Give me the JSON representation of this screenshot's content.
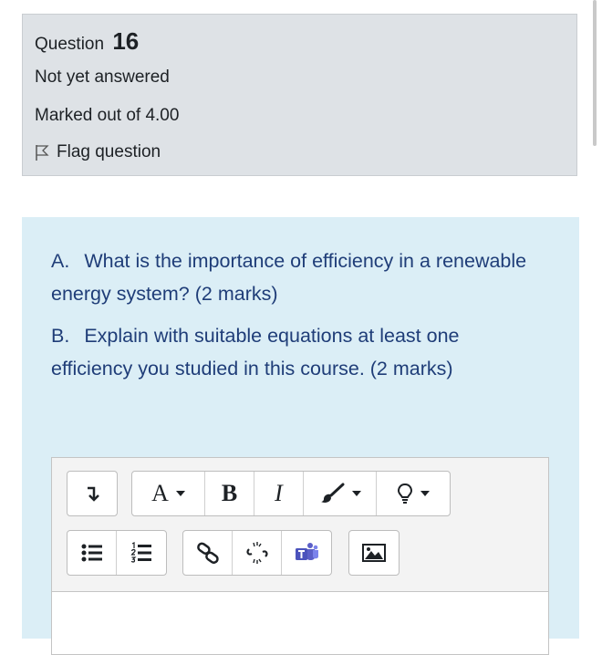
{
  "question_info": {
    "label": "Question",
    "number": "16",
    "state": "Not yet answered",
    "grade": "Marked out of 4.00",
    "flag_label": "Flag question"
  },
  "question_text": {
    "parts": [
      {
        "label": "A.",
        "text": "What is the importance of efficiency in a renewable energy system? (2 marks)"
      },
      {
        "label": "B.",
        "text": "Explain with suitable equations at least one efficiency you studied in this course. (2 marks)"
      }
    ]
  },
  "editor": {
    "row1": [
      "toggle-toolbar-icon",
      "font-size-icon",
      "bold-icon",
      "italic-icon",
      "brush-icon",
      "lightbulb-icon"
    ],
    "row2": [
      "bullet-list-icon",
      "numbered-list-icon",
      "link-icon",
      "unlink-icon",
      "teams-icon",
      "image-icon"
    ],
    "font_button": "A",
    "bold_button": "B",
    "italic_button": "I"
  },
  "colors": {
    "info_bg": "#dee2e6",
    "content_bg": "#dbeef6",
    "question_text": "#1f3d78"
  }
}
